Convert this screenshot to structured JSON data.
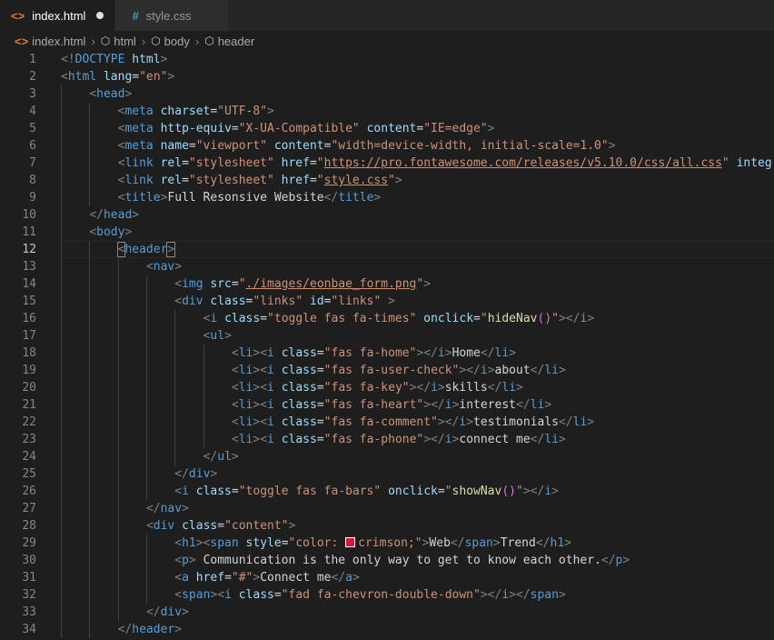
{
  "tabs": [
    {
      "label": "index.html",
      "active": true,
      "icon": "html-icon",
      "dirty": true
    },
    {
      "label": "style.css",
      "active": false,
      "icon": "css-hash-icon",
      "dirty": false
    }
  ],
  "breadcrumb": [
    "index.html",
    "html",
    "body",
    "header"
  ],
  "current_line": 12,
  "colors": {
    "swatch": "#dc143c"
  },
  "lines": [
    {
      "n": "1",
      "indent": 0,
      "tokens": [
        [
          "br",
          "<!"
        ],
        [
          "tag",
          "DOCTYPE"
        ],
        [
          "txt",
          " "
        ],
        [
          "attr",
          "html"
        ],
        [
          "br",
          ">"
        ]
      ]
    },
    {
      "n": "2",
      "indent": 0,
      "tokens": [
        [
          "br",
          "<"
        ],
        [
          "tag",
          "html"
        ],
        [
          "txt",
          " "
        ],
        [
          "attr",
          "lang"
        ],
        [
          "txt",
          "="
        ],
        [
          "str",
          "\"en\""
        ],
        [
          "br",
          ">"
        ]
      ]
    },
    {
      "n": "3",
      "indent": 1,
      "tokens": [
        [
          "br",
          "<"
        ],
        [
          "tag",
          "head"
        ],
        [
          "br",
          ">"
        ]
      ]
    },
    {
      "n": "4",
      "indent": 2,
      "tokens": [
        [
          "br",
          "<"
        ],
        [
          "tag",
          "meta"
        ],
        [
          "txt",
          " "
        ],
        [
          "attr",
          "charset"
        ],
        [
          "txt",
          "="
        ],
        [
          "str",
          "\"UTF-8\""
        ],
        [
          "br",
          ">"
        ]
      ]
    },
    {
      "n": "5",
      "indent": 2,
      "tokens": [
        [
          "br",
          "<"
        ],
        [
          "tag",
          "meta"
        ],
        [
          "txt",
          " "
        ],
        [
          "attr",
          "http-equiv"
        ],
        [
          "txt",
          "="
        ],
        [
          "str",
          "\"X-UA-Compatible\""
        ],
        [
          "txt",
          " "
        ],
        [
          "attr",
          "content"
        ],
        [
          "txt",
          "="
        ],
        [
          "str",
          "\"IE=edge\""
        ],
        [
          "br",
          ">"
        ]
      ]
    },
    {
      "n": "6",
      "indent": 2,
      "tokens": [
        [
          "br",
          "<"
        ],
        [
          "tag",
          "meta"
        ],
        [
          "txt",
          " "
        ],
        [
          "attr",
          "name"
        ],
        [
          "txt",
          "="
        ],
        [
          "str",
          "\"viewport\""
        ],
        [
          "txt",
          " "
        ],
        [
          "attr",
          "content"
        ],
        [
          "txt",
          "="
        ],
        [
          "str",
          "\"width=device-width, initial-scale=1.0\""
        ],
        [
          "br",
          ">"
        ]
      ]
    },
    {
      "n": "7",
      "indent": 2,
      "tokens": [
        [
          "br",
          "<"
        ],
        [
          "tag",
          "link"
        ],
        [
          "txt",
          " "
        ],
        [
          "attr",
          "rel"
        ],
        [
          "txt",
          "="
        ],
        [
          "str",
          "\"stylesheet\""
        ],
        [
          "txt",
          " "
        ],
        [
          "attr",
          "href"
        ],
        [
          "txt",
          "="
        ],
        [
          "str",
          "\""
        ],
        [
          "url",
          "https://pro.fontawesome.com/releases/v5.10.0/css/all.css"
        ],
        [
          "str",
          "\""
        ],
        [
          "txt",
          " "
        ],
        [
          "attr",
          "integri"
        ]
      ]
    },
    {
      "n": "8",
      "indent": 2,
      "tokens": [
        [
          "br",
          "<"
        ],
        [
          "tag",
          "link"
        ],
        [
          "txt",
          " "
        ],
        [
          "attr",
          "rel"
        ],
        [
          "txt",
          "="
        ],
        [
          "str",
          "\"stylesheet\""
        ],
        [
          "txt",
          " "
        ],
        [
          "attr",
          "href"
        ],
        [
          "txt",
          "="
        ],
        [
          "str",
          "\""
        ],
        [
          "url",
          "style.css"
        ],
        [
          "str",
          "\""
        ],
        [
          "br",
          ">"
        ]
      ]
    },
    {
      "n": "9",
      "indent": 2,
      "tokens": [
        [
          "br",
          "<"
        ],
        [
          "tag",
          "title"
        ],
        [
          "br",
          ">"
        ],
        [
          "txt",
          "Full Resonsive Website"
        ],
        [
          "br",
          "</"
        ],
        [
          "tag",
          "title"
        ],
        [
          "br",
          ">"
        ]
      ]
    },
    {
      "n": "10",
      "indent": 1,
      "tokens": [
        [
          "br",
          "</"
        ],
        [
          "tag",
          "head"
        ],
        [
          "br",
          ">"
        ]
      ]
    },
    {
      "n": "11",
      "indent": 1,
      "tokens": [
        [
          "br",
          "<"
        ],
        [
          "tag",
          "body"
        ],
        [
          "br",
          ">"
        ]
      ]
    },
    {
      "n": "12",
      "indent": 2,
      "tokens": [
        [
          "brm",
          "<"
        ],
        [
          "tag",
          "header"
        ],
        [
          "brm",
          ">"
        ]
      ]
    },
    {
      "n": "13",
      "indent": 3,
      "tokens": [
        [
          "br",
          "<"
        ],
        [
          "tag",
          "nav"
        ],
        [
          "br",
          ">"
        ]
      ]
    },
    {
      "n": "14",
      "indent": 4,
      "tokens": [
        [
          "br",
          "<"
        ],
        [
          "tag",
          "img"
        ],
        [
          "txt",
          " "
        ],
        [
          "attr",
          "src"
        ],
        [
          "txt",
          "="
        ],
        [
          "str",
          "\""
        ],
        [
          "url",
          "./images/eonbae_form.png"
        ],
        [
          "str",
          "\""
        ],
        [
          "br",
          ">"
        ]
      ]
    },
    {
      "n": "15",
      "indent": 4,
      "tokens": [
        [
          "br",
          "<"
        ],
        [
          "tag",
          "div"
        ],
        [
          "txt",
          " "
        ],
        [
          "attr",
          "class"
        ],
        [
          "txt",
          "="
        ],
        [
          "str",
          "\"links\""
        ],
        [
          "txt",
          " "
        ],
        [
          "attr",
          "id"
        ],
        [
          "txt",
          "="
        ],
        [
          "str",
          "\"links\""
        ],
        [
          "txt",
          " "
        ],
        [
          "br",
          ">"
        ]
      ]
    },
    {
      "n": "16",
      "indent": 5,
      "tokens": [
        [
          "br",
          "<"
        ],
        [
          "tag",
          "i"
        ],
        [
          "txt",
          " "
        ],
        [
          "attr",
          "class"
        ],
        [
          "txt",
          "="
        ],
        [
          "str",
          "\"toggle fas fa-times\""
        ],
        [
          "txt",
          " "
        ],
        [
          "attr",
          "onclick"
        ],
        [
          "txt",
          "="
        ],
        [
          "str",
          "\""
        ],
        [
          "fn",
          "hideNav"
        ],
        [
          "pn",
          "()"
        ],
        [
          "str",
          "\""
        ],
        [
          "br",
          "></"
        ],
        [
          "tag",
          "i"
        ],
        [
          "br",
          ">"
        ]
      ]
    },
    {
      "n": "17",
      "indent": 5,
      "tokens": [
        [
          "br",
          "<"
        ],
        [
          "tag",
          "ul"
        ],
        [
          "br",
          ">"
        ]
      ]
    },
    {
      "n": "18",
      "indent": 6,
      "tokens": [
        [
          "br",
          "<"
        ],
        [
          "tag",
          "li"
        ],
        [
          "br",
          "><"
        ],
        [
          "tag",
          "i"
        ],
        [
          "txt",
          " "
        ],
        [
          "attr",
          "class"
        ],
        [
          "txt",
          "="
        ],
        [
          "str",
          "\"fas fa-home\""
        ],
        [
          "br",
          "></"
        ],
        [
          "tag",
          "i"
        ],
        [
          "br",
          ">"
        ],
        [
          "txt",
          "Home"
        ],
        [
          "br",
          "</"
        ],
        [
          "tag",
          "li"
        ],
        [
          "br",
          ">"
        ]
      ]
    },
    {
      "n": "19",
      "indent": 6,
      "tokens": [
        [
          "br",
          "<"
        ],
        [
          "tag",
          "li"
        ],
        [
          "br",
          "><"
        ],
        [
          "tag",
          "i"
        ],
        [
          "txt",
          " "
        ],
        [
          "attr",
          "class"
        ],
        [
          "txt",
          "="
        ],
        [
          "str",
          "\"fas fa-user-check\""
        ],
        [
          "br",
          "></"
        ],
        [
          "tag",
          "i"
        ],
        [
          "br",
          ">"
        ],
        [
          "txt",
          "about"
        ],
        [
          "br",
          "</"
        ],
        [
          "tag",
          "li"
        ],
        [
          "br",
          ">"
        ]
      ]
    },
    {
      "n": "20",
      "indent": 6,
      "tokens": [
        [
          "br",
          "<"
        ],
        [
          "tag",
          "li"
        ],
        [
          "br",
          "><"
        ],
        [
          "tag",
          "i"
        ],
        [
          "txt",
          " "
        ],
        [
          "attr",
          "class"
        ],
        [
          "txt",
          "="
        ],
        [
          "str",
          "\"fas fa-key\""
        ],
        [
          "br",
          "></"
        ],
        [
          "tag",
          "i"
        ],
        [
          "br",
          ">"
        ],
        [
          "txt",
          "skills"
        ],
        [
          "br",
          "</"
        ],
        [
          "tag",
          "li"
        ],
        [
          "br",
          ">"
        ]
      ]
    },
    {
      "n": "21",
      "indent": 6,
      "tokens": [
        [
          "br",
          "<"
        ],
        [
          "tag",
          "li"
        ],
        [
          "br",
          "><"
        ],
        [
          "tag",
          "i"
        ],
        [
          "txt",
          " "
        ],
        [
          "attr",
          "class"
        ],
        [
          "txt",
          "="
        ],
        [
          "str",
          "\"fas fa-heart\""
        ],
        [
          "br",
          "></"
        ],
        [
          "tag",
          "i"
        ],
        [
          "br",
          ">"
        ],
        [
          "txt",
          "interest"
        ],
        [
          "br",
          "</"
        ],
        [
          "tag",
          "li"
        ],
        [
          "br",
          ">"
        ]
      ]
    },
    {
      "n": "22",
      "indent": 6,
      "tokens": [
        [
          "br",
          "<"
        ],
        [
          "tag",
          "li"
        ],
        [
          "br",
          "><"
        ],
        [
          "tag",
          "i"
        ],
        [
          "txt",
          " "
        ],
        [
          "attr",
          "class"
        ],
        [
          "txt",
          "="
        ],
        [
          "str",
          "\"fas fa-comment\""
        ],
        [
          "br",
          "></"
        ],
        [
          "tag",
          "i"
        ],
        [
          "br",
          ">"
        ],
        [
          "txt",
          "testimonials"
        ],
        [
          "br",
          "</"
        ],
        [
          "tag",
          "li"
        ],
        [
          "br",
          ">"
        ]
      ]
    },
    {
      "n": "23",
      "indent": 6,
      "tokens": [
        [
          "br",
          "<"
        ],
        [
          "tag",
          "li"
        ],
        [
          "br",
          "><"
        ],
        [
          "tag",
          "i"
        ],
        [
          "txt",
          " "
        ],
        [
          "attr",
          "class"
        ],
        [
          "txt",
          "="
        ],
        [
          "str",
          "\"fas fa-phone\""
        ],
        [
          "br",
          "></"
        ],
        [
          "tag",
          "i"
        ],
        [
          "br",
          ">"
        ],
        [
          "txt",
          "connect me"
        ],
        [
          "br",
          "</"
        ],
        [
          "tag",
          "li"
        ],
        [
          "br",
          ">"
        ]
      ]
    },
    {
      "n": "24",
      "indent": 5,
      "tokens": [
        [
          "br",
          "</"
        ],
        [
          "tag",
          "ul"
        ],
        [
          "br",
          ">"
        ]
      ]
    },
    {
      "n": "25",
      "indent": 4,
      "tokens": [
        [
          "br",
          "</"
        ],
        [
          "tag",
          "div"
        ],
        [
          "br",
          ">"
        ]
      ]
    },
    {
      "n": "26",
      "indent": 4,
      "tokens": [
        [
          "br",
          "<"
        ],
        [
          "tag",
          "i"
        ],
        [
          "txt",
          " "
        ],
        [
          "attr",
          "class"
        ],
        [
          "txt",
          "="
        ],
        [
          "str",
          "\"toggle fas fa-bars\""
        ],
        [
          "txt",
          " "
        ],
        [
          "attr",
          "onclick"
        ],
        [
          "txt",
          "="
        ],
        [
          "str",
          "\""
        ],
        [
          "fn",
          "showNav"
        ],
        [
          "pn",
          "()"
        ],
        [
          "str",
          "\""
        ],
        [
          "br",
          "></"
        ],
        [
          "tag",
          "i"
        ],
        [
          "br",
          ">"
        ]
      ]
    },
    {
      "n": "27",
      "indent": 3,
      "tokens": [
        [
          "br",
          "</"
        ],
        [
          "tag",
          "nav"
        ],
        [
          "br",
          ">"
        ]
      ]
    },
    {
      "n": "28",
      "indent": 3,
      "tokens": [
        [
          "br",
          "<"
        ],
        [
          "tag",
          "div"
        ],
        [
          "txt",
          " "
        ],
        [
          "attr",
          "class"
        ],
        [
          "txt",
          "="
        ],
        [
          "str",
          "\"content\""
        ],
        [
          "br",
          ">"
        ]
      ]
    },
    {
      "n": "29",
      "indent": 4,
      "tokens": [
        [
          "br",
          "<"
        ],
        [
          "tag",
          "h1"
        ],
        [
          "br",
          "><"
        ],
        [
          "tag",
          "span"
        ],
        [
          "txt",
          " "
        ],
        [
          "attr",
          "style"
        ],
        [
          "txt",
          "="
        ],
        [
          "str",
          "\"color: "
        ],
        [
          "swatch",
          ""
        ],
        [
          "str",
          "crimson;\""
        ],
        [
          "br",
          ">"
        ],
        [
          "txt",
          "Web"
        ],
        [
          "br",
          "</"
        ],
        [
          "tag",
          "span"
        ],
        [
          "br",
          ">"
        ],
        [
          "txt",
          "Trend"
        ],
        [
          "br",
          "</"
        ],
        [
          "tag",
          "h1"
        ],
        [
          "br",
          ">"
        ]
      ]
    },
    {
      "n": "30",
      "indent": 4,
      "tokens": [
        [
          "br",
          "<"
        ],
        [
          "tag",
          "p"
        ],
        [
          "br",
          ">"
        ],
        [
          "txt",
          " Communication is the only way to get to know each other."
        ],
        [
          "br",
          "</"
        ],
        [
          "tag",
          "p"
        ],
        [
          "br",
          ">"
        ]
      ]
    },
    {
      "n": "31",
      "indent": 4,
      "tokens": [
        [
          "br",
          "<"
        ],
        [
          "tag",
          "a"
        ],
        [
          "txt",
          " "
        ],
        [
          "attr",
          "href"
        ],
        [
          "txt",
          "="
        ],
        [
          "str",
          "\"#\""
        ],
        [
          "br",
          ">"
        ],
        [
          "txt",
          "Connect me"
        ],
        [
          "br",
          "</"
        ],
        [
          "tag",
          "a"
        ],
        [
          "br",
          ">"
        ]
      ]
    },
    {
      "n": "32",
      "indent": 4,
      "tokens": [
        [
          "br",
          "<"
        ],
        [
          "tag",
          "span"
        ],
        [
          "br",
          "><"
        ],
        [
          "tag",
          "i"
        ],
        [
          "txt",
          " "
        ],
        [
          "attr",
          "class"
        ],
        [
          "txt",
          "="
        ],
        [
          "str",
          "\"fad fa-chevron-double-down\""
        ],
        [
          "br",
          "></"
        ],
        [
          "tag",
          "i"
        ],
        [
          "br",
          "></"
        ],
        [
          "tag",
          "span"
        ],
        [
          "br",
          ">"
        ]
      ]
    },
    {
      "n": "33",
      "indent": 3,
      "tokens": [
        [
          "br",
          "</"
        ],
        [
          "tag",
          "div"
        ],
        [
          "br",
          ">"
        ]
      ]
    },
    {
      "n": "34",
      "indent": 2,
      "tokens": [
        [
          "br",
          "</"
        ],
        [
          "tag",
          "header"
        ],
        [
          "br",
          ">"
        ]
      ]
    }
  ]
}
